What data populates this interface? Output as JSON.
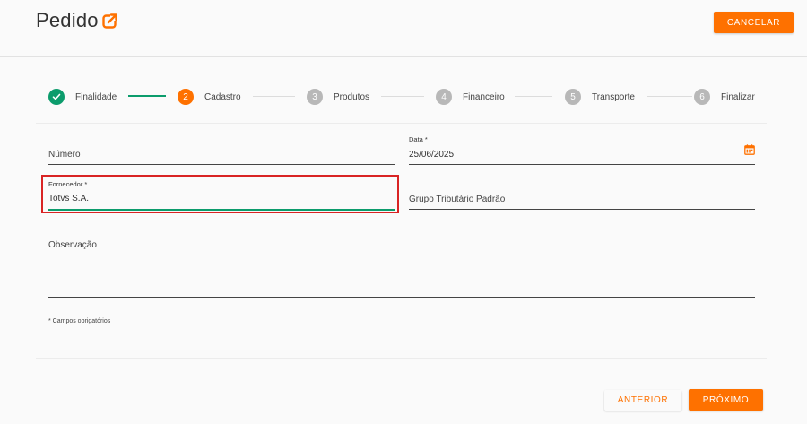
{
  "header": {
    "title": "Pedido",
    "title_icon": "open-external-icon",
    "cancel_label": "CANCELAR"
  },
  "stepper": {
    "steps": [
      {
        "label": "Finalidade",
        "number": "",
        "state": "done"
      },
      {
        "label": "Cadastro",
        "number": "2",
        "state": "active"
      },
      {
        "label": "Produtos",
        "number": "3",
        "state": "pending"
      },
      {
        "label": "Financeiro",
        "number": "4",
        "state": "pending"
      },
      {
        "label": "Transporte",
        "number": "5",
        "state": "pending"
      },
      {
        "label": "Finalizar",
        "number": "6",
        "state": "pending"
      }
    ]
  },
  "form": {
    "numero": {
      "label": "Número",
      "value": ""
    },
    "data": {
      "label": "Data *",
      "value": "25/06/2025"
    },
    "fornecedor": {
      "label": "Fornecedor *",
      "value": "Totvs S.A."
    },
    "grupo_tributario": {
      "label": "Grupo Tributário Padrão",
      "value": ""
    },
    "observacao": {
      "label": "Observação",
      "value": ""
    },
    "required_note": "* Campos obrigatórios"
  },
  "footer": {
    "previous_label": "ANTERIOR",
    "next_label": "PRÓXIMO"
  },
  "colors": {
    "accent": "#fe7100",
    "success": "#0c9c6c",
    "pending": "#b8b8b8",
    "highlight": "#d92424"
  }
}
